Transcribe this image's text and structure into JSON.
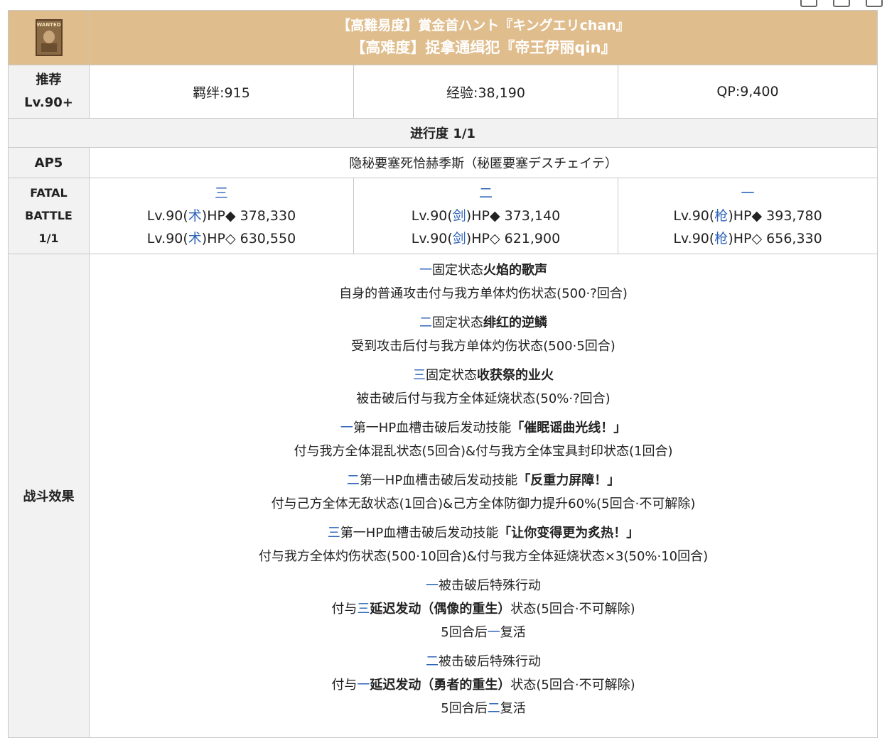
{
  "header": {
    "logo_text": "WANTED",
    "title_jp": "【高難易度】賞金首ハント『キングエリchan』",
    "title_cn": "【高难度】捉拿通缉犯『帝王伊丽qin』"
  },
  "reward_row": {
    "label_line1": "推荐",
    "label_line2": "Lv.90+",
    "bond": "羁绊:915",
    "exp": "经验:38,190",
    "qp": "QP:9,400"
  },
  "progress": "进行度 1/1",
  "ap_row": {
    "label": "AP5",
    "location": "隐秘要塞死恰赫季斯（秘匿要塞デスチェイテ）"
  },
  "enemy_row": {
    "label_line1": "FATAL",
    "label_line2": "BATTLE",
    "label_line3": "1/1",
    "enemies": [
      {
        "marker": "三",
        "class_name": "术",
        "hp_prefix": "Lv.90(",
        "hp_mid": ")HP",
        "hp1": "◆ 378,330",
        "hp2": "◇ 630,550"
      },
      {
        "marker": "二",
        "class_name": "剑",
        "hp_prefix": "Lv.90(",
        "hp_mid": ")HP",
        "hp1": "◆ 373,140",
        "hp2": "◇ 621,900"
      },
      {
        "marker": "一",
        "class_name": "枪",
        "hp_prefix": "Lv.90(",
        "hp_mid": ")HP",
        "hp1": "◆ 393,780",
        "hp2": "◇ 656,330"
      }
    ]
  },
  "effects_row": {
    "label": "战斗效果",
    "effects": [
      {
        "marker": "一",
        "prefix": "固定状态",
        "bold": "火焰的歌声",
        "suffix": "",
        "desc": "自身的普通攻击付与我方单体灼伤状态(500·?回合)"
      },
      {
        "marker": "二",
        "prefix": "固定状态",
        "bold": "绯红的逆鳞",
        "suffix": "",
        "desc": "受到攻击后付与我方单体灼伤状态(500·5回合)"
      },
      {
        "marker": "三",
        "prefix": "固定状态",
        "bold": "收获祭的业火",
        "suffix": "",
        "desc": "被击破后付与我方全体延烧状态(50%·?回合)"
      },
      {
        "marker": "一",
        "prefix": "第一HP血槽击破后发动技能",
        "bold": "「催眠谣曲光线！」",
        "suffix": "",
        "desc": "付与我方全体混乱状态(5回合)&付与我方全体宝具封印状态(1回合)"
      },
      {
        "marker": "二",
        "prefix": "第一HP血槽击破后发动技能",
        "bold": "「反重力屏障！」",
        "suffix": "",
        "desc": "付与己方全体无敌状态(1回合)&己方全体防御力提升60%(5回合·不可解除)"
      },
      {
        "marker": "三",
        "prefix": "第一HP血槽击破后发动技能",
        "bold": "「让你变得更为炙热！」",
        "suffix": "",
        "desc": "付与我方全体灼伤状态(500·10回合)&付与我方全体延烧状态×3(50%·10回合)"
      }
    ],
    "special": [
      {
        "marker": "一",
        "title": "被击破后特殊行动",
        "pre": "付与",
        "target": "三",
        "bold": "延迟发动（偶像的重生）",
        "post": "状态(5回合·不可解除)",
        "revive_pre": "5回合后",
        "revive_target": "一",
        "revive_post": "复活"
      },
      {
        "marker": "二",
        "title": "被击破后特殊行动",
        "pre": "付与",
        "target": "一",
        "bold": "延迟发动（勇者的重生）",
        "post": "状态(5回合·不可解除)",
        "revive_pre": "5回合后",
        "revive_target": "二",
        "revive_post": "复活"
      }
    ]
  }
}
